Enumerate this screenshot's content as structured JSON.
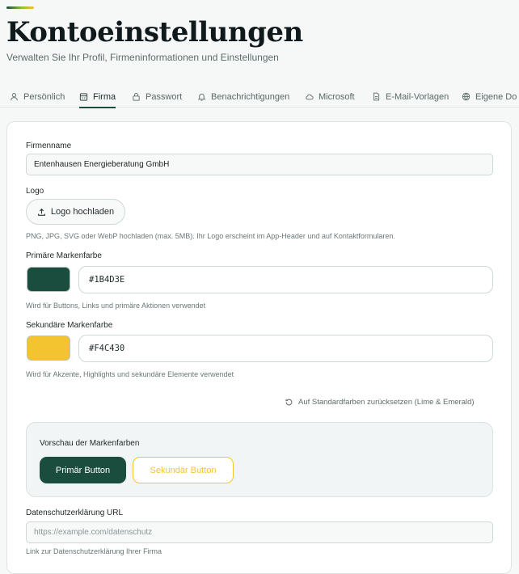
{
  "header": {
    "title": "Kontoeinstellungen",
    "subtitle": "Verwalten Sie Ihr Profil, Firmeninformationen und Einstellungen"
  },
  "tabs": [
    {
      "label": "Persönlich",
      "icon": "user-icon",
      "active": false
    },
    {
      "label": "Firma",
      "icon": "building-icon",
      "active": true
    },
    {
      "label": "Passwort",
      "icon": "lock-icon",
      "active": false
    },
    {
      "label": "Benachrichtigungen",
      "icon": "bell-icon",
      "active": false
    },
    {
      "label": "Microsoft",
      "icon": "cloud-icon",
      "active": false
    },
    {
      "label": "E-Mail-Vorlagen",
      "icon": "document-icon",
      "active": false
    },
    {
      "label": "Eigene Do",
      "icon": "globe-icon",
      "active": false
    }
  ],
  "company": {
    "name_label": "Firmenname",
    "name_value": "Entenhausen Energieberatung GmbH",
    "logo_label": "Logo",
    "logo_button": "Logo hochladen",
    "logo_hint": "PNG, JPG, SVG oder WebP hochladen (max. 5MB). Ihr Logo erscheint im App-Header und auf Kontaktformularen.",
    "primary_label": "Primäre Markenfarbe",
    "primary_hex": "#1B4D3E",
    "primary_hint": "Wird für Buttons, Links und primäre Aktionen verwendet",
    "secondary_label": "Sekundäre Markenfarbe",
    "secondary_hex": "#F4C430",
    "secondary_hint": "Wird für Akzente, Highlights und sekundäre Elemente verwendet",
    "reset_label": "Auf Standardfarben zurücksetzen (Lime & Emerald)",
    "preview_title": "Vorschau der Markenfarben",
    "preview_primary_button": "Primär Button",
    "preview_secondary_button": "Sekundär Button",
    "privacy_label": "Datenschutzerklärung URL",
    "privacy_placeholder": "https://example.com/datenschutz",
    "privacy_hint": "Link zur Datenschutzerklärung Ihrer Firma"
  },
  "colors": {
    "primary": "#1b4d3e",
    "secondary": "#f4c430",
    "accent_gradient": [
      "#1b4d3e",
      "#8fbf3a",
      "#f4c430"
    ]
  }
}
